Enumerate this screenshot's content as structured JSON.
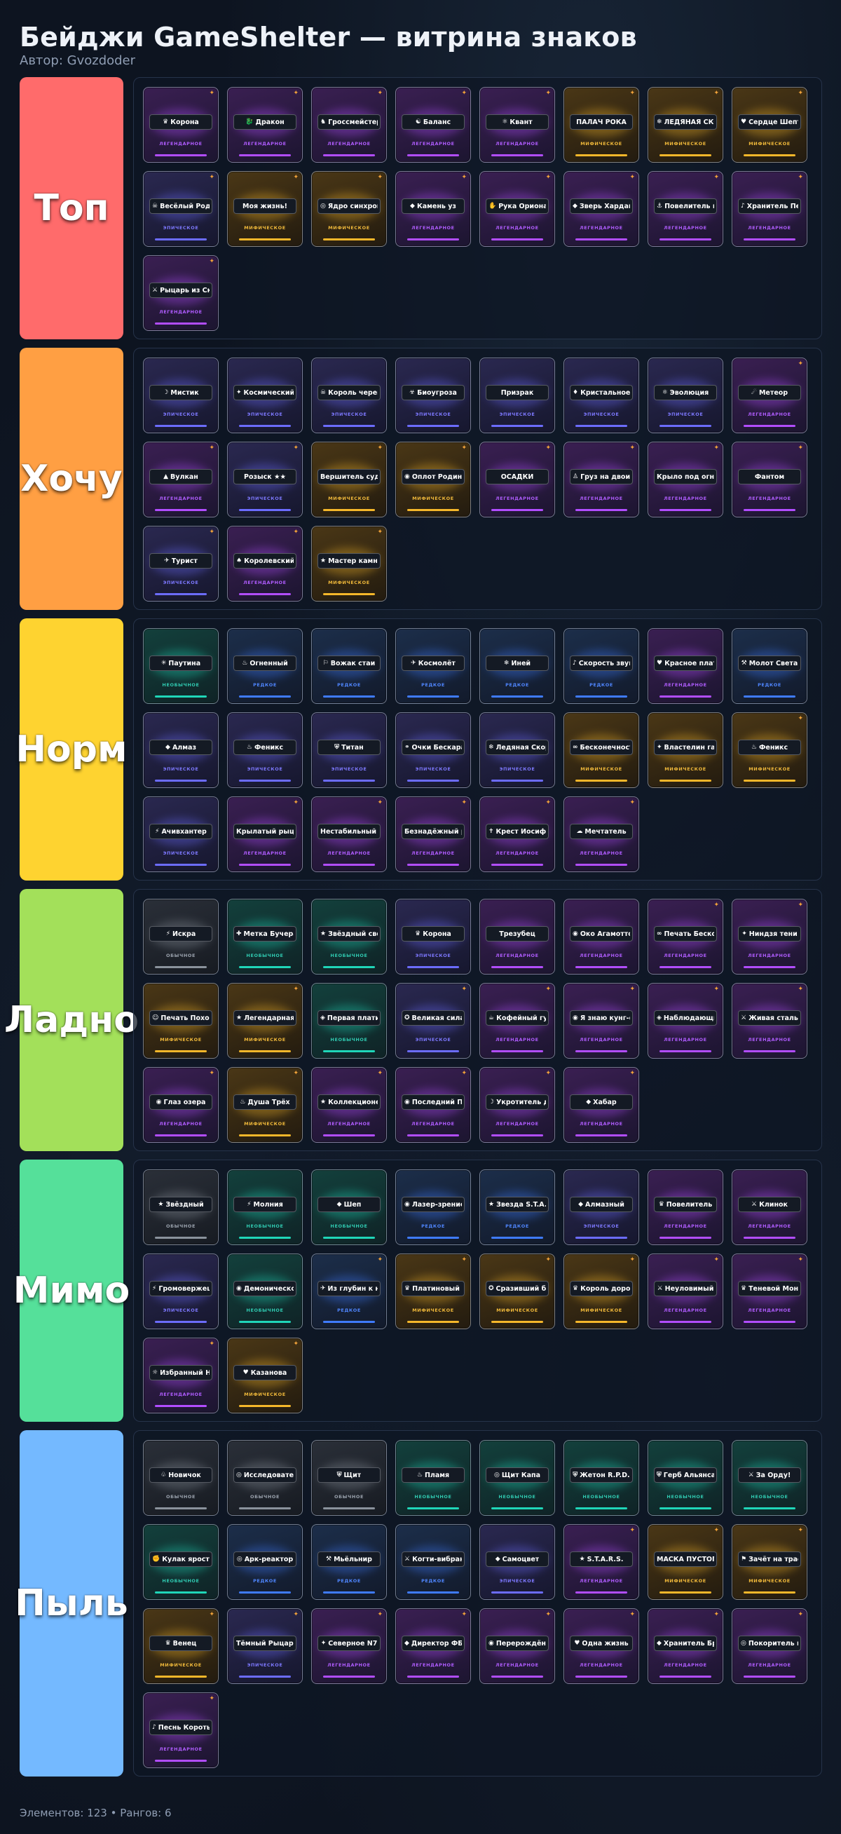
{
  "title": "Бейджи GameShelter — витрина знаков",
  "author": "Автор: Gvozdoder",
  "footer": "Элементов: 123 • Рангов: 6",
  "rarity_labels": {
    "common": "ОБЫЧНОЕ",
    "uncommon": "НЕОБЫЧНОЕ",
    "rare": "РЕДКОЕ",
    "epic": "ЭПИЧЕСКОЕ",
    "legendary": "ЛЕГЕНДАРНОЕ",
    "mythic": "МИФИЧЕСКОЕ"
  },
  "tiers": [
    {
      "label": "Топ",
      "color": "#ff6b6b",
      "badges": [
        {
          "name": "Корона",
          "icon": "♛",
          "rarity": "legendary",
          "star": true
        },
        {
          "name": "Дракон",
          "icon": "🐉",
          "rarity": "legendary",
          "star": true
        },
        {
          "name": "Гроссмейстер",
          "icon": "♞",
          "rarity": "legendary",
          "star": true
        },
        {
          "name": "Баланс",
          "icon": "☯",
          "rarity": "legendary",
          "star": true
        },
        {
          "name": "Квант",
          "icon": "⚛",
          "rarity": "legendary",
          "star": true
        },
        {
          "name": "ПАЛАЧ РОКА",
          "icon": "",
          "rarity": "mythic",
          "star": true
        },
        {
          "name": "ЛЕДЯНАЯ СКОРБЬ",
          "icon": "❄",
          "rarity": "mythic",
          "star": true
        },
        {
          "name": "Сердце Шептера",
          "icon": "♥",
          "rarity": "mythic",
          "star": true
        },
        {
          "name": "Весёлый Роджер",
          "icon": "☠",
          "rarity": "epic",
          "star": true
        },
        {
          "name": "Моя жизнь!",
          "icon": "",
          "rarity": "mythic",
          "star": true
        },
        {
          "name": "Ядро синхронизации",
          "icon": "◎",
          "rarity": "mythic",
          "star": true
        },
        {
          "name": "Камень уз",
          "icon": "◆",
          "rarity": "legendary",
          "star": true
        },
        {
          "name": "Рука Ориона",
          "icon": "✋",
          "rarity": "legendary",
          "star": true
        },
        {
          "name": "Зверь Хардана",
          "icon": "◆",
          "rarity": "legendary",
          "star": true
        },
        {
          "name": "Повелитель морей",
          "icon": "⚓",
          "rarity": "legendary",
          "star": true
        },
        {
          "name": "Хранитель Первой Симфонии",
          "icon": "♪",
          "rarity": "legendary",
          "star": true
        },
        {
          "name": "Рыцарь из Скалицы",
          "icon": "⚔",
          "rarity": "legendary",
          "star": true
        }
      ]
    },
    {
      "label": "Хочу",
      "color": "#ff9f43",
      "badges": [
        {
          "name": "Мистик",
          "icon": "☽",
          "rarity": "epic",
          "star": false
        },
        {
          "name": "Космический",
          "icon": "✦",
          "rarity": "epic",
          "star": false
        },
        {
          "name": "Король черепов",
          "icon": "☠",
          "rarity": "epic",
          "star": false
        },
        {
          "name": "Биоугроза",
          "icon": "☣",
          "rarity": "epic",
          "star": false
        },
        {
          "name": "Призрак",
          "icon": "",
          "rarity": "epic",
          "star": false
        },
        {
          "name": "Кристальное сердце",
          "icon": "♦",
          "rarity": "epic",
          "star": false
        },
        {
          "name": "Эволюция",
          "icon": "⚛",
          "rarity": "epic",
          "star": false
        },
        {
          "name": "Метеор",
          "icon": "☄",
          "rarity": "legendary",
          "star": true
        },
        {
          "name": "Вулкан",
          "icon": "▲",
          "rarity": "legendary",
          "star": true
        },
        {
          "name": "Розыск ★★",
          "icon": "",
          "rarity": "epic",
          "star": true
        },
        {
          "name": "Вершитель судеб",
          "icon": "",
          "rarity": "mythic",
          "star": true
        },
        {
          "name": "Оплот Родины",
          "icon": "◉",
          "rarity": "mythic",
          "star": true
        },
        {
          "name": "ОСАДКИ",
          "icon": "",
          "rarity": "legendary",
          "star": true
        },
        {
          "name": "Груз на двоих",
          "icon": "♙",
          "rarity": "legendary",
          "star": true
        },
        {
          "name": "Крыло под огнём",
          "icon": "",
          "rarity": "legendary",
          "star": true
        },
        {
          "name": "Фантом",
          "icon": "",
          "rarity": "legendary",
          "star": true
        },
        {
          "name": "Турист",
          "icon": "✈",
          "rarity": "epic",
          "star": true
        },
        {
          "name": "Королевский Шут",
          "icon": "♠",
          "rarity": "legendary",
          "star": true
        },
        {
          "name": "Мастер камней и пушек",
          "icon": "★",
          "rarity": "mythic",
          "star": true
        }
      ]
    },
    {
      "label": "Норм",
      "color": "#fed330",
      "badges": [
        {
          "name": "Паутина",
          "icon": "✳",
          "rarity": "uncommon",
          "star": false
        },
        {
          "name": "Огненный",
          "icon": "♨",
          "rarity": "rare",
          "star": false
        },
        {
          "name": "Вожак стаи",
          "icon": "⚐",
          "rarity": "rare",
          "star": false
        },
        {
          "name": "Космолёт",
          "icon": "✈",
          "rarity": "rare",
          "star": false
        },
        {
          "name": "Иней",
          "icon": "❄",
          "rarity": "rare",
          "star": false
        },
        {
          "name": "Скорость звука",
          "icon": "♪",
          "rarity": "rare",
          "star": false
        },
        {
          "name": "Красное платье",
          "icon": "♥",
          "rarity": "legendary",
          "star": false
        },
        {
          "name": "Молот Света",
          "icon": "⚒",
          "rarity": "rare",
          "star": false
        },
        {
          "name": "Алмаз",
          "icon": "◆",
          "rarity": "epic",
          "star": false
        },
        {
          "name": "Феникс",
          "icon": "♨",
          "rarity": "epic",
          "star": false
        },
        {
          "name": "Титан",
          "icon": "⛨",
          "rarity": "epic",
          "star": false
        },
        {
          "name": "Очки Бескара",
          "icon": "⚭",
          "rarity": "epic",
          "star": false
        },
        {
          "name": "Ледяная Скорбь",
          "icon": "❄",
          "rarity": "epic",
          "star": false
        },
        {
          "name": "Бесконечность",
          "icon": "∞",
          "rarity": "mythic",
          "star": false
        },
        {
          "name": "Властелин галактик",
          "icon": "✦",
          "rarity": "mythic",
          "star": false
        },
        {
          "name": "Феникс",
          "icon": "♨",
          "rarity": "mythic",
          "star": true
        },
        {
          "name": "Ачивхантер",
          "icon": "⚡",
          "rarity": "epic",
          "star": false
        },
        {
          "name": "Крылатый рыцарь",
          "icon": "",
          "rarity": "legendary",
          "star": true
        },
        {
          "name": "Нестабильный разум",
          "icon": "",
          "rarity": "legendary",
          "star": true
        },
        {
          "name": "Безнадёжный романтик",
          "icon": "",
          "rarity": "legendary",
          "star": true
        },
        {
          "name": "Крест Иосифа",
          "icon": "✝",
          "rarity": "legendary",
          "star": true
        },
        {
          "name": "Мечтатель",
          "icon": "☁",
          "rarity": "legendary",
          "star": true
        }
      ]
    },
    {
      "label": "Ладно",
      "color": "#a3e05a",
      "badges": [
        {
          "name": "Искра",
          "icon": "⚡",
          "rarity": "common",
          "star": false
        },
        {
          "name": "Метка Бучера",
          "icon": "✚",
          "rarity": "uncommon",
          "star": false
        },
        {
          "name": "Звёздный свет",
          "icon": "★",
          "rarity": "uncommon",
          "star": false
        },
        {
          "name": "Корона",
          "icon": "♛",
          "rarity": "epic",
          "star": false
        },
        {
          "name": "Трезубец",
          "icon": "",
          "rarity": "legendary",
          "star": false
        },
        {
          "name": "Око Агамотто",
          "icon": "◉",
          "rarity": "legendary",
          "star": false
        },
        {
          "name": "Печать Бесконечности",
          "icon": "∞",
          "rarity": "legendary",
          "star": true
        },
        {
          "name": "Ниндзя тени",
          "icon": "✦",
          "rarity": "legendary",
          "star": true
        },
        {
          "name": "Печать Похода",
          "icon": "☺",
          "rarity": "mythic",
          "star": false
        },
        {
          "name": "Легендарная звезда",
          "icon": "★",
          "rarity": "mythic",
          "star": true
        },
        {
          "name": "Первая платина",
          "icon": "◈",
          "rarity": "uncommon",
          "star": false
        },
        {
          "name": "Великая сила",
          "icon": "✪",
          "rarity": "epic",
          "star": true
        },
        {
          "name": "Кофейный гуру",
          "icon": "☕",
          "rarity": "legendary",
          "star": true
        },
        {
          "name": "Я знаю кунг-фу",
          "icon": "◉",
          "rarity": "legendary",
          "star": true
        },
        {
          "name": "Наблюдающий хвост",
          "icon": "◈",
          "rarity": "legendary",
          "star": true
        },
        {
          "name": "Живая сталь",
          "icon": "⚔",
          "rarity": "legendary",
          "star": true
        },
        {
          "name": "Глаз озера",
          "icon": "◉",
          "rarity": "legendary",
          "star": true
        },
        {
          "name": "Душа Трёх",
          "icon": "♨",
          "rarity": "mythic",
          "star": true
        },
        {
          "name": "Коллекционер игр",
          "icon": "★",
          "rarity": "legendary",
          "star": true
        },
        {
          "name": "Последний Предтеча",
          "icon": "◉",
          "rarity": "legendary",
          "star": true
        },
        {
          "name": "Укротитель демонов",
          "icon": "☽",
          "rarity": "legendary",
          "star": true
        },
        {
          "name": "Хабар",
          "icon": "◆",
          "rarity": "legendary",
          "star": true
        }
      ]
    },
    {
      "label": "Мимо",
      "color": "#55e09a",
      "badges": [
        {
          "name": "Звёздный",
          "icon": "★",
          "rarity": "common",
          "star": false
        },
        {
          "name": "Молния",
          "icon": "⚡",
          "rarity": "uncommon",
          "star": false
        },
        {
          "name": "Шеп",
          "icon": "◆",
          "rarity": "uncommon",
          "star": false
        },
        {
          "name": "Лазер-зрение",
          "icon": "◉",
          "rarity": "rare",
          "star": false
        },
        {
          "name": "Звезда S.T.A.R.S.",
          "icon": "★",
          "rarity": "rare",
          "star": false
        },
        {
          "name": "Алмазный",
          "icon": "◆",
          "rarity": "epic",
          "star": false
        },
        {
          "name": "Повелитель",
          "icon": "♛",
          "rarity": "legendary",
          "star": false
        },
        {
          "name": "Клинок",
          "icon": "⚔",
          "rarity": "legendary",
          "star": false
        },
        {
          "name": "Громовержец",
          "icon": "⚡",
          "rarity": "epic",
          "star": false
        },
        {
          "name": "Демоническое око",
          "icon": "◉",
          "rarity": "uncommon",
          "star": false
        },
        {
          "name": "Из глубин к небесам",
          "icon": "✈",
          "rarity": "rare",
          "star": true
        },
        {
          "name": "Платиновый идол",
          "icon": "♛",
          "rarity": "mythic",
          "star": true
        },
        {
          "name": "Сразивший богов",
          "icon": "✪",
          "rarity": "mythic",
          "star": true
        },
        {
          "name": "Король дороги",
          "icon": "♛",
          "rarity": "mythic",
          "star": true
        },
        {
          "name": "Неуловимый",
          "icon": "⚔",
          "rarity": "legendary",
          "star": true
        },
        {
          "name": "Теневой Монарх",
          "icon": "♛",
          "rarity": "legendary",
          "star": true
        },
        {
          "name": "Избранный Небесами",
          "icon": "☼",
          "rarity": "legendary",
          "star": true
        },
        {
          "name": "Казанова",
          "icon": "♥",
          "rarity": "mythic",
          "star": true
        }
      ]
    },
    {
      "label": "Пыль",
      "color": "#74b9ff",
      "badges": [
        {
          "name": "Новичок",
          "icon": "♧",
          "rarity": "common",
          "star": false
        },
        {
          "name": "Исследователь",
          "icon": "◎",
          "rarity": "common",
          "star": false
        },
        {
          "name": "Щит",
          "icon": "⛨",
          "rarity": "common",
          "star": false
        },
        {
          "name": "Пламя",
          "icon": "♨",
          "rarity": "uncommon",
          "star": false
        },
        {
          "name": "Щит Капа",
          "icon": "◎",
          "rarity": "uncommon",
          "star": false
        },
        {
          "name": "Жетон R.P.D.",
          "icon": "⛨",
          "rarity": "uncommon",
          "star": false
        },
        {
          "name": "Герб Альянса",
          "icon": "⛨",
          "rarity": "uncommon",
          "star": false
        },
        {
          "name": "За Орду!",
          "icon": "⚔",
          "rarity": "uncommon",
          "star": false
        },
        {
          "name": "Кулак ярости",
          "icon": "✊",
          "rarity": "uncommon",
          "star": false
        },
        {
          "name": "Арк-реактор",
          "icon": "◎",
          "rarity": "rare",
          "star": false
        },
        {
          "name": "Мьёльнир",
          "icon": "⚒",
          "rarity": "rare",
          "star": false
        },
        {
          "name": "Когти-вибраниума",
          "icon": "⚔",
          "rarity": "rare",
          "star": false
        },
        {
          "name": "Самоцвет",
          "icon": "◆",
          "rarity": "epic",
          "star": false
        },
        {
          "name": "S.T.A.R.S.",
          "icon": "★",
          "rarity": "legendary",
          "star": true
        },
        {
          "name": "МАСКА ПУСТОГО",
          "icon": "",
          "rarity": "mythic",
          "star": true
        },
        {
          "name": "Зачёт на трассе",
          "icon": "⚑",
          "rarity": "mythic",
          "star": true
        },
        {
          "name": "Венец",
          "icon": "♛",
          "rarity": "mythic",
          "star": true
        },
        {
          "name": "Тёмный Рыцарь",
          "icon": "",
          "rarity": "epic",
          "star": true
        },
        {
          "name": "Северное N7",
          "icon": "✦",
          "rarity": "legendary",
          "star": true
        },
        {
          "name": "Директор ФБК",
          "icon": "◆",
          "rarity": "legendary",
          "star": true
        },
        {
          "name": "Перерождённый",
          "icon": "◉",
          "rarity": "legendary",
          "star": true
        },
        {
          "name": "Одна жизнь",
          "icon": "♥",
          "rarity": "legendary",
          "star": true
        },
        {
          "name": "Хранитель Братства",
          "icon": "◆",
          "rarity": "legendary",
          "star": true
        },
        {
          "name": "Покоритель циклов",
          "icon": "◎",
          "rarity": "legendary",
          "star": true
        },
        {
          "name": "Песнь Коротыри",
          "icon": "♪",
          "rarity": "legendary",
          "star": true
        }
      ]
    }
  ]
}
